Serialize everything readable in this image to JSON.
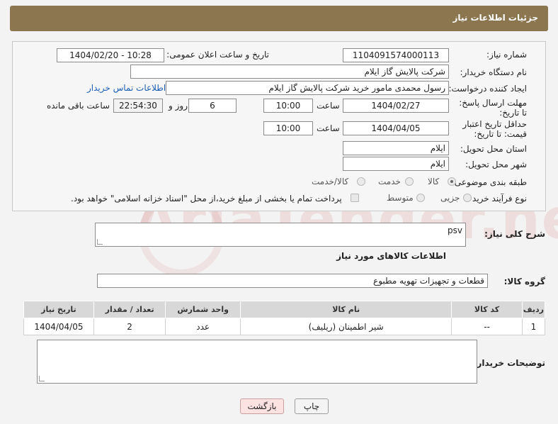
{
  "header": {
    "title": "جزئیات اطلاعات نیاز"
  },
  "form": {
    "need_number_label": "شماره نیاز:",
    "need_number": "1104091574000113",
    "announce_label": "تاریخ و ساعت اعلان عمومی:",
    "announce_value": "1404/02/20 - 10:28",
    "buyer_label": "نام دستگاه خریدار:",
    "buyer_value": "شرکت پالایش گاز ایلام",
    "creator_label": "ایجاد کننده درخواست:",
    "creator_value": "رسول محمدی مامور خرید شرکت پالایش گاز ایلام",
    "contact_link": "اطلاعات تماس خریدار",
    "reply_deadline_label": "مهلت ارسال پاسخ: تا تاریخ:",
    "reply_date": "1404/02/27",
    "time_label": "ساعت",
    "reply_time": "10:00",
    "days_value": "6",
    "days_label": "روز و",
    "remaining_time": "22:54:30",
    "remaining_label": "ساعت باقی مانده",
    "price_validity_label": "حداقل تاریخ اعتبار قیمت: تا تاریخ:",
    "validity_date": "1404/04/05",
    "validity_time_label": "ساعت",
    "validity_time": "10:00",
    "province_label": "استان محل تحویل:",
    "province_value": "ایلام",
    "city_label": "شهر محل تحویل:",
    "city_value": "ایلام",
    "category_label": "طبقه بندی موضوعی:",
    "category_options": [
      "کالا",
      "خدمت",
      "کالا/خدمت"
    ],
    "category_selected": "کالا",
    "process_label": "نوع فرآیند خرید :",
    "process_options": [
      "جزیی",
      "متوسط"
    ],
    "payment_note": "پرداخت تمام یا بخشی از مبلغ خرید،از محل \"اسناد خزانه اسلامی\" خواهد بود."
  },
  "description": {
    "label": "شرح کلی نیاز:",
    "value": "psv"
  },
  "goods_section": {
    "title": "اطلاعات کالاهای مورد نیاز",
    "group_label": "گروه کالا:",
    "group_value": "قطعات و تجهیزات تهویه مطبوع"
  },
  "table": {
    "headers": [
      "ردیف",
      "کد کالا",
      "نام کالا",
      "واحد شمارش",
      "تعداد / مقدار",
      "تاریخ نیاز"
    ],
    "rows": [
      [
        "1",
        "--",
        "شیر اطمینان (ریلیف)",
        "عدد",
        "2",
        "1404/04/05"
      ]
    ]
  },
  "buyer_notes": {
    "label": "توضیحات خریدار:",
    "value": ""
  },
  "buttons": {
    "print": "چاپ",
    "back": "بازگشت"
  },
  "watermark": {
    "text": "AriaTender.net"
  },
  "colors": {
    "header": "#8b7650",
    "link": "#1a5fb4",
    "back_button": "#fde2e2"
  }
}
